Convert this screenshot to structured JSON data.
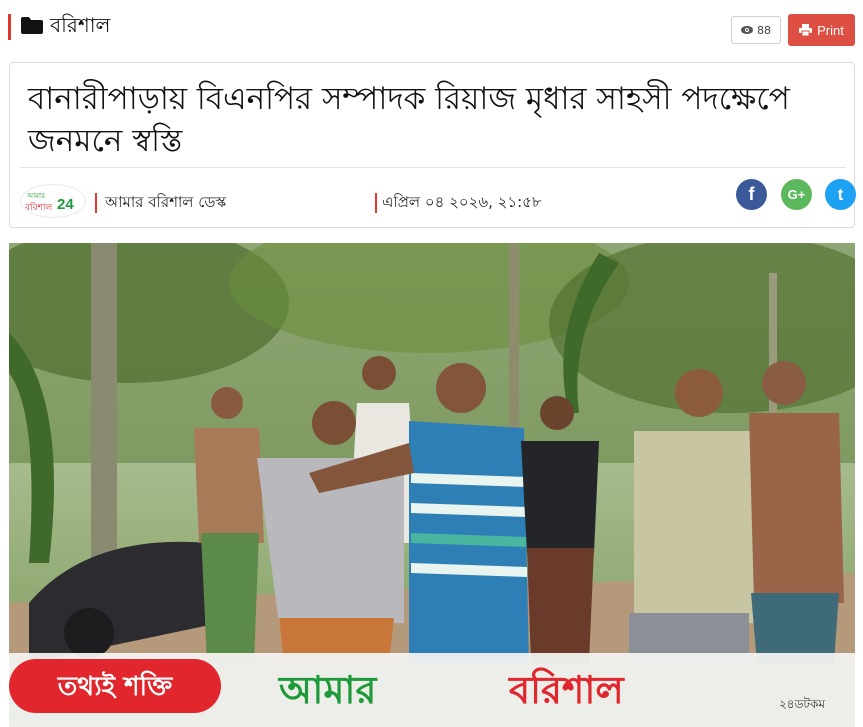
{
  "category": {
    "label": "বরিশাল",
    "icon": "folder-icon"
  },
  "toolbar": {
    "views_count": "88",
    "print_label": "Print"
  },
  "article": {
    "title": "বানারীপাড়ায় বিএনপির সম্পাদক রিয়াজ মৃধার সাহসী পদক্ষেপে জনমনে স্বস্তি",
    "author": "আমার বরিশাল ডেস্ক",
    "date": "এপ্রিল ০৪ ২০২৬, ২১:৫৮"
  },
  "logo": {
    "line1": "আমার",
    "line2": "বরিশাল",
    "number": "24"
  },
  "share": [
    {
      "name": "facebook",
      "glyph": "f",
      "color": "#3b5998"
    },
    {
      "name": "google-plus",
      "glyph": "G+",
      "color": "#5cb85c"
    },
    {
      "name": "twitter",
      "glyph": "t",
      "color": "#1da1f2"
    }
  ],
  "photo_banner": {
    "slogan": "তথ্যই শক্তি",
    "brand_part1": "আমার",
    "brand_part2": "বরিশাল",
    "domain": "২৪ডটকম"
  },
  "colors": {
    "accent_red": "#e0392b",
    "print_button": "#dd4f43",
    "brand_green": "#1e9a3b",
    "brand_red": "#e1262d"
  }
}
